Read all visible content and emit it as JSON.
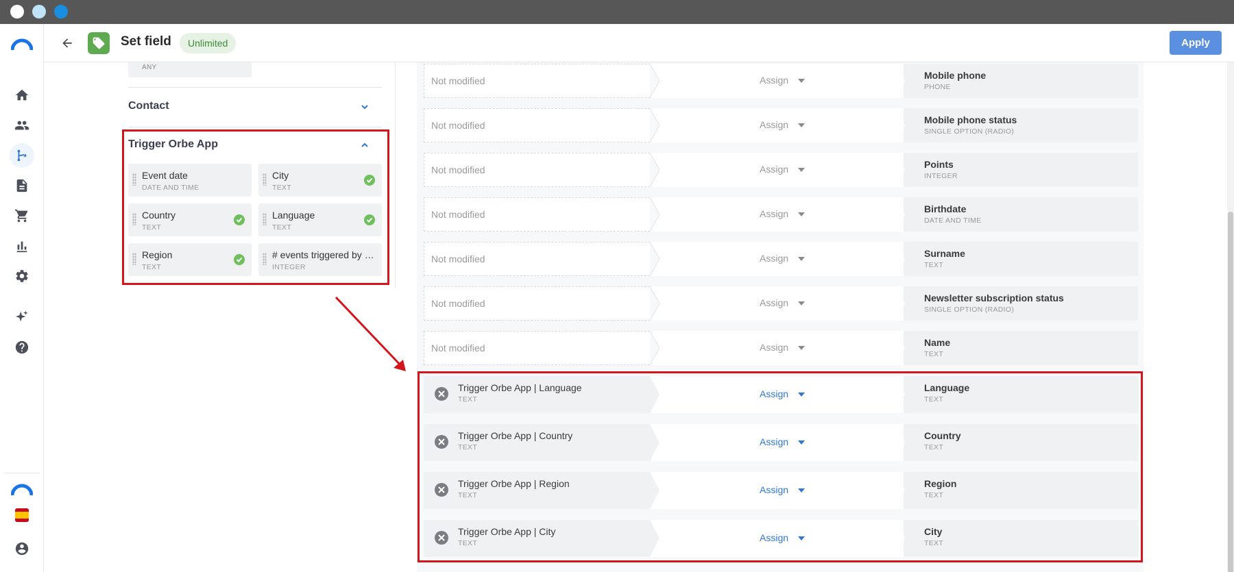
{
  "header": {
    "title": "Set field",
    "badge": "Unlimited",
    "apply_label": "Apply"
  },
  "left_panel": {
    "any_type_label": "ANY",
    "sections": [
      {
        "title": "Contact",
        "expanded": false
      },
      {
        "title": "Trigger Orbe App",
        "expanded": true
      }
    ],
    "fields": [
      {
        "name": "Event date",
        "type": "DATE AND TIME",
        "used": false
      },
      {
        "name": "City",
        "type": "TEXT",
        "used": true
      },
      {
        "name": "Country",
        "type": "TEXT",
        "used": true
      },
      {
        "name": "Language",
        "type": "TEXT",
        "used": true
      },
      {
        "name": "Region",
        "type": "TEXT",
        "used": true
      },
      {
        "name": "# events triggered by t...",
        "type": "INTEGER",
        "used": false
      }
    ]
  },
  "mapping": {
    "not_modified_label": "Not modified",
    "assign_label": "Assign",
    "unmapped_rows": [
      {
        "target": "Mobile phone",
        "target_type": "PHONE"
      },
      {
        "target": "Mobile phone status",
        "target_type": "SINGLE OPTION (RADIO)"
      },
      {
        "target": "Points",
        "target_type": "INTEGER"
      },
      {
        "target": "Birthdate",
        "target_type": "DATE AND TIME"
      },
      {
        "target": "Surname",
        "target_type": "TEXT"
      },
      {
        "target": "Newsletter subscription status",
        "target_type": "SINGLE OPTION (RADIO)"
      },
      {
        "target": "Name",
        "target_type": "TEXT"
      }
    ],
    "mapped_rows": [
      {
        "source": "Trigger Orbe App | Language",
        "source_type": "TEXT",
        "target": "Language",
        "target_type": "TEXT"
      },
      {
        "source": "Trigger Orbe App | Country",
        "source_type": "TEXT",
        "target": "Country",
        "target_type": "TEXT"
      },
      {
        "source": "Trigger Orbe App | Region",
        "source_type": "TEXT",
        "target": "Region",
        "target_type": "TEXT"
      },
      {
        "source": "Trigger Orbe App | City",
        "source_type": "TEXT",
        "target": "City",
        "target_type": "TEXT"
      }
    ]
  },
  "colors": {
    "accent": "#2f77d1",
    "highlight": "#d4161c",
    "success": "#6fbf5c"
  },
  "icons": [
    "home-icon",
    "contacts-icon",
    "flows-icon",
    "document-icon",
    "cart-icon",
    "reports-icon",
    "settings-icon",
    "ai-sparkle-icon",
    "help-icon",
    "brand-logo-icon",
    "spain-flag-icon",
    "account-icon"
  ]
}
